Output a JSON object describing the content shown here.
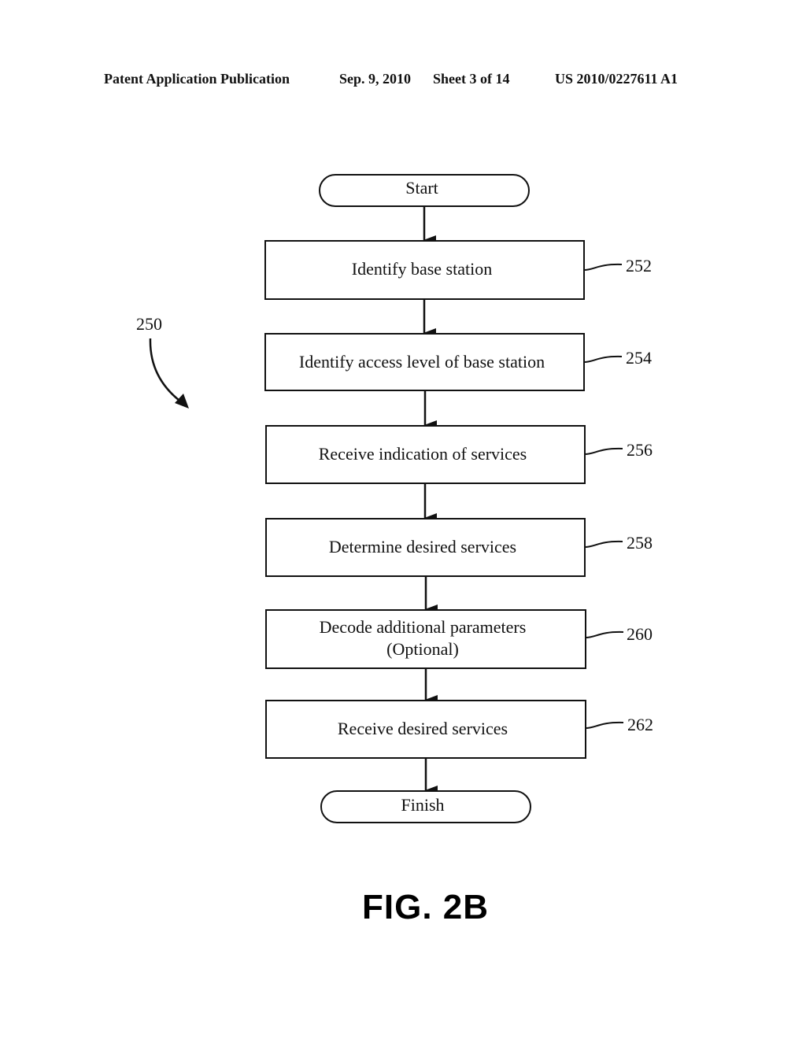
{
  "header": {
    "publication_type": "Patent Application Publication",
    "date": "Sep. 9, 2010",
    "sheet": "Sheet 3 of 14",
    "publication_number": "US 2010/0227611 A1"
  },
  "diagram": {
    "reference": "250",
    "start_label": "Start",
    "finish_label": "Finish",
    "steps": [
      {
        "ref": "252",
        "lines": [
          "Identify base station"
        ]
      },
      {
        "ref": "254",
        "lines": [
          "Identify access level of base station"
        ]
      },
      {
        "ref": "256",
        "lines": [
          "Receive indication of services"
        ]
      },
      {
        "ref": "258",
        "lines": [
          "Determine desired services"
        ]
      },
      {
        "ref": "260",
        "lines": [
          "Decode additional parameters",
          "(Optional)"
        ]
      },
      {
        "ref": "262",
        "lines": [
          "Receive desired services"
        ]
      }
    ]
  },
  "figure_label": "FIG. 2B"
}
